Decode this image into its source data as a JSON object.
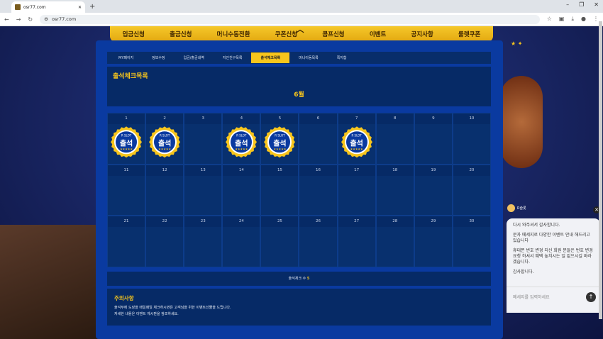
{
  "browser": {
    "tab_title": "osr77.com",
    "new_tab": "+",
    "url": "osr77.com",
    "win_min": "–",
    "win_max": "❐",
    "win_close": "✕"
  },
  "nav": {
    "items": [
      "입금신청",
      "출금신청",
      "머니수동전환",
      "쿠폰신청",
      "콤프신청",
      "이벤트",
      "공지사항",
      "룰렛쿠폰"
    ]
  },
  "subnav": {
    "items": [
      "MY페이지",
      "정보수정",
      "입금/출금내역",
      "지인친구목록",
      "출석체크목록",
      "머니이동목록",
      "쪽지함"
    ],
    "active_index": 4
  },
  "attendance": {
    "title": "출석체크목록",
    "month": "6월",
    "stamp_brand": "R SLOT",
    "stamp_text": "출석",
    "stamp_stars": "★★★★★",
    "days": [
      1,
      2,
      3,
      4,
      5,
      6,
      7,
      8,
      9,
      10,
      11,
      12,
      13,
      14,
      15,
      16,
      17,
      18,
      19,
      20,
      21,
      22,
      23,
      24,
      25,
      26,
      27,
      28,
      29,
      30
    ],
    "stamped": [
      1,
      2,
      4,
      5,
      7
    ],
    "count_label": "출석체크 수 ",
    "count_value": "5"
  },
  "notice": {
    "title": "주의사항",
    "line1": "출석부에 도장을 매일매일 체크하시면은 고객님을 위한 이벤트선물을 드립니다.",
    "line2": "자세한 내용은 이벤트 게시판을 참조하세요."
  },
  "chat": {
    "agent_name": "R슬롯",
    "msg1": "다시 와주셔서 감사합니다.",
    "msg2": "문자 메세지로 다양한 이벤트 안내 해드리고 있습니다",
    "msg3": "휴대폰 번호 변경 되신 회원 분들은 번호 변경 요청 하셔서 혜택 놓치시는 일 없으시길 바라겠습니다.",
    "msg4": "감사합니다.",
    "input_placeholder": "메세지를 입력하세요"
  },
  "colors": {
    "accent": "#f7c51c",
    "panel": "#0a3aa0"
  }
}
